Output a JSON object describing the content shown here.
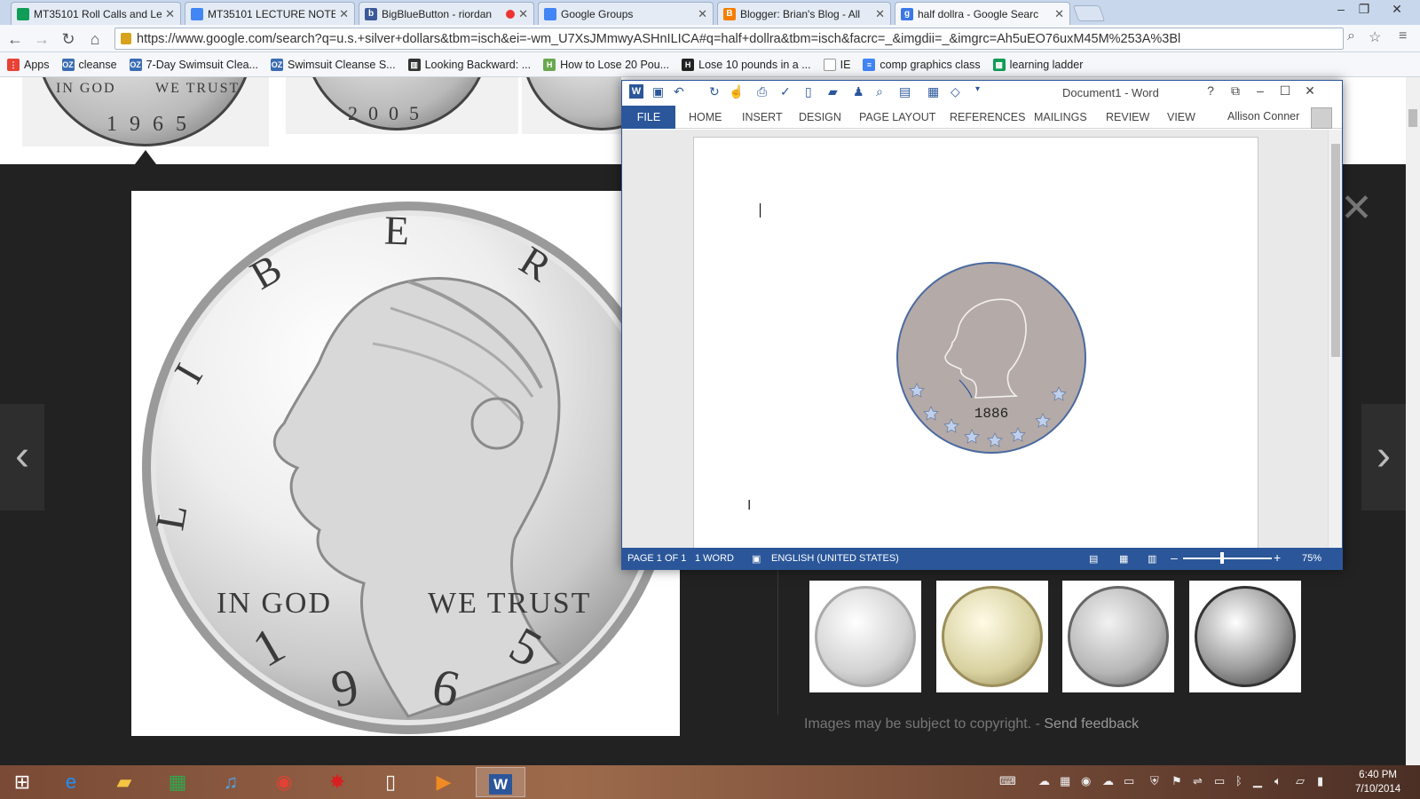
{
  "browser": {
    "tabs": [
      {
        "title": "MT35101 Roll Calls and Le",
        "favicon": "sheets-icon",
        "color": "#0f9d58"
      },
      {
        "title": "MT35101 LECTURE NOTES",
        "favicon": "docs-icon",
        "color": "#4285f4"
      },
      {
        "title": "BigBlueButton - riordan",
        "favicon": "bigbluebutton-icon",
        "color": "#3b5998"
      },
      {
        "title": "Google Groups",
        "favicon": "groups-icon",
        "color": "#4285f4"
      },
      {
        "title": "Blogger: Brian's Blog - All",
        "favicon": "blogger-icon",
        "color": "#f57d00"
      },
      {
        "title": "half dollra - Google Searc",
        "favicon": "google-icon",
        "color": "#3b78e7"
      }
    ],
    "url": "https://www.google.com/search?q=u.s.+silver+dollars&tbm=isch&ei=-wm_U7XsJMmwyASHnILICA#q=half+dollra&tbm=isch&facrc=_&imgdii=_&imgrc=Ah5uEO76uxM45M%253A%3Bl",
    "bookmarks": [
      {
        "label": "Apps",
        "icon": "apps-grid-icon",
        "color": "#e94235"
      },
      {
        "label": "cleanse",
        "icon": "oz-icon",
        "color": "#3b6db3"
      },
      {
        "label": "7-Day Swimsuit Clea...",
        "icon": "oz-icon",
        "color": "#3b6db3"
      },
      {
        "label": "Swimsuit Cleanse S...",
        "icon": "oz-icon",
        "color": "#3b6db3"
      },
      {
        "label": "Looking Backward: ...",
        "icon": "book-icon",
        "color": "#333333"
      },
      {
        "label": "How to Lose 20 Pou...",
        "icon": "h-icon",
        "color": "#6aa84f"
      },
      {
        "label": "Lose 10 pounds in a ...",
        "icon": "h-icon",
        "color": "#222222"
      },
      {
        "label": "IE",
        "icon": "page-icon",
        "color": "#999999"
      },
      {
        "label": "comp graphics class",
        "icon": "docs-icon",
        "color": "#4285f4"
      },
      {
        "label": "learning ladder",
        "icon": "sheets-icon",
        "color": "#0f9d58"
      }
    ]
  },
  "images": {
    "main_coin": {
      "legend_top": "LIBERTY",
      "left_letters": "LIB",
      "motto_left": "IN GOD",
      "motto_right": "WE TRUST",
      "year": "1965",
      "top_year_a": "1965",
      "top_year_b": "2005"
    },
    "copyright": "Images may be subject to copyright.",
    "separator": " - ",
    "feedback": "Send feedback"
  },
  "word": {
    "title": "Document1 - Word",
    "help": "?",
    "ribbon_tabs": [
      "FILE",
      "HOME",
      "INSERT",
      "DESIGN",
      "PAGE LAYOUT",
      "REFERENCES",
      "MAILINGS",
      "REVIEW",
      "VIEW"
    ],
    "user": "Allison Conner",
    "drawing_year": "1886",
    "status": {
      "page": "PAGE 1 OF 1",
      "words": "1 WORD",
      "language": "ENGLISH (UNITED STATES)",
      "zoom": "75%"
    }
  },
  "taskbar": {
    "apps": [
      "windows-start-icon",
      "internet-explorer-icon",
      "file-explorer-icon",
      "store-icon",
      "itunes-icon",
      "chrome-icon",
      "red-app-icon",
      "blank-file-icon",
      "media-player-icon",
      "word-icon"
    ],
    "time": "6:40 PM",
    "date": "7/10/2014"
  },
  "colors": {
    "word_blue": "#2b579a",
    "coin_fill": "#b4aaa7",
    "chrome_frame": "#c8d7ec"
  }
}
